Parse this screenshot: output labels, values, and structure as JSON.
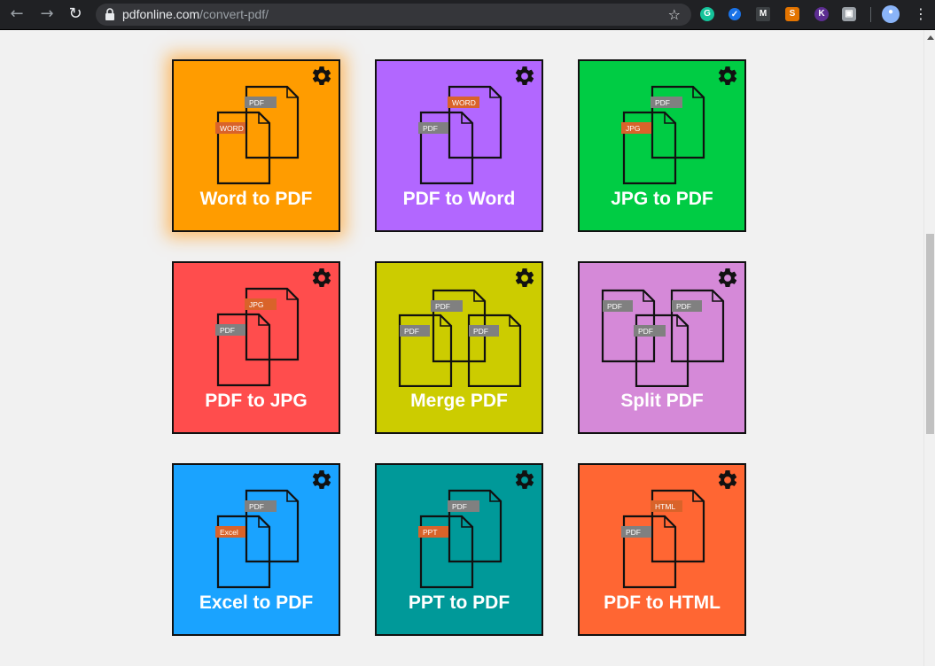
{
  "browser": {
    "url_host": "pdfonline.com",
    "url_path": "/convert-pdf/"
  },
  "colors": {
    "word_to_pdf": "#ff9c00",
    "pdf_to_word": "#b267ff",
    "jpg_to_pdf": "#00cc44",
    "pdf_to_jpg": "#ff4d4d",
    "merge_pdf": "#cccc00",
    "split_pdf": "#d589d8",
    "excel_to_pdf": "#1aa3ff",
    "ppt_to_pdf": "#009999",
    "pdf_to_html": "#ff6633",
    "tag_grey": "#808080",
    "tag_orange": "#d9632a"
  },
  "tiles": [
    {
      "label": "Word to PDF",
      "back_tag": "PDF",
      "front_tag": "WORD"
    },
    {
      "label": "PDF to Word",
      "back_tag": "WORD",
      "front_tag": "PDF"
    },
    {
      "label": "JPG to PDF",
      "back_tag": "PDF",
      "front_tag": "JPG"
    },
    {
      "label": "PDF to JPG",
      "back_tag": "JPG",
      "front_tag": "PDF"
    },
    {
      "label": "Merge PDF",
      "tags": [
        "PDF",
        "PDF",
        "PDF"
      ]
    },
    {
      "label": "Split PDF",
      "tags": [
        "PDF",
        "PDF",
        "PDF"
      ]
    },
    {
      "label": "Excel to PDF",
      "back_tag": "PDF",
      "front_tag": "Excel"
    },
    {
      "label": "PPT to PDF",
      "back_tag": "PDF",
      "front_tag": "PPT"
    },
    {
      "label": "PDF to HTML",
      "back_tag": "HTML",
      "front_tag": "PDF"
    }
  ]
}
